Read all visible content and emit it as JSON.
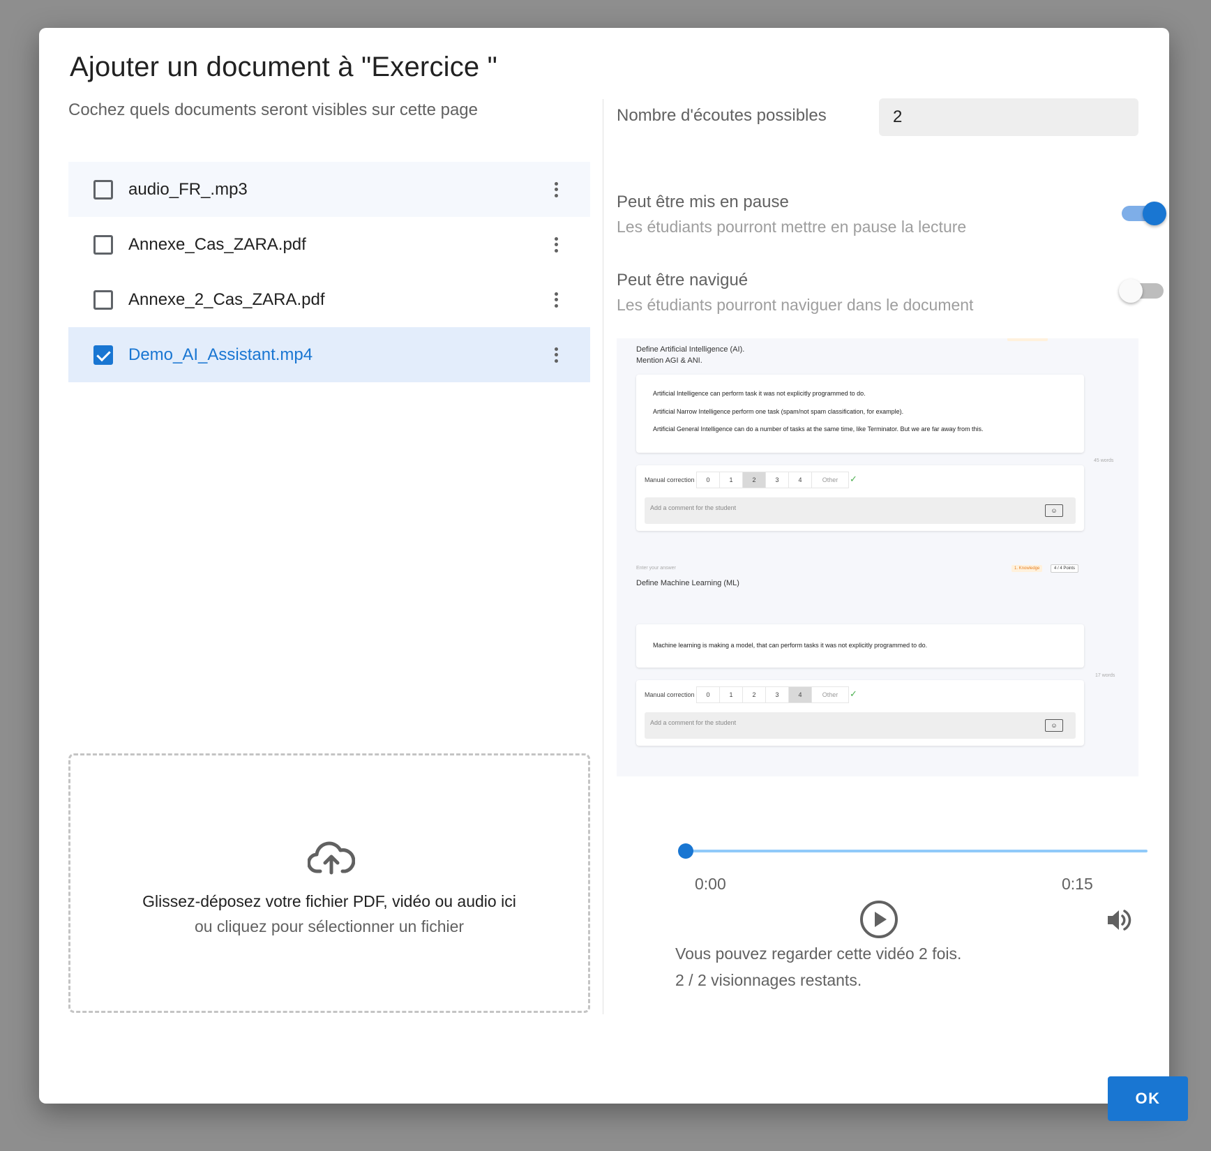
{
  "dialog": {
    "title": "Ajouter un document à \"Exercice \"",
    "subtitle": "Cochez quels documents seront visibles sur cette page",
    "ok_label": "OK"
  },
  "files": [
    {
      "name": "audio_FR_.mp3",
      "checked": false
    },
    {
      "name": "Annexe_Cas_ZARA.pdf",
      "checked": false
    },
    {
      "name": "Annexe_2_Cas_ZARA.pdf",
      "checked": false
    },
    {
      "name": "Demo_AI_Assistant.mp4",
      "checked": true
    }
  ],
  "dropzone": {
    "icon": "cloud-upload-icon",
    "title": "Glissez-déposez votre fichier PDF, vidéo ou audio ici",
    "subtitle": "ou cliquez pour sélectionner un fichier"
  },
  "settings": {
    "plays_label": "Nombre d'écoutes possibles",
    "plays_value": "2",
    "pause": {
      "title": "Peut être mis en pause",
      "description": "Les étudiants pourront mettre en pause la lecture",
      "enabled": true
    },
    "navigate": {
      "title": "Peut être navigué",
      "description": "Les étudiants pourront naviguer dans le document",
      "enabled": false
    }
  },
  "preview": {
    "q1_prompt": "Define Artificial Intelligence (AI).",
    "q1_prompt2": "Mention AGI & ANI.",
    "q1_answer": [
      "Artificial Intelligence can perform task it was not explicitly programmed to do.",
      "Artificial Narrow Intelligence perform one task (spam/not spam classification, for example).",
      "Artificial General Intelligence can do a number of tasks at the same time, like Terminator. But we are far away from this."
    ],
    "q1_words": "45 words",
    "manual_correction": "Manual correction",
    "scores": [
      "0",
      "1",
      "2",
      "3",
      "4",
      "Other"
    ],
    "q1_selected": 2,
    "comment_placeholder": "Add a comment for the student",
    "q2_hint": "Enter your answer",
    "q2_tag": "1. Knowledge",
    "q2_points": "4 / 4 Points",
    "q2_prompt": "Define Machine Learning (ML)",
    "q2_answer": "Machine learning is making a model, that can perform tasks it was not explicitly programmed to do.",
    "q2_words": "17 words",
    "q2_selected": 4
  },
  "player": {
    "current_time": "0:00",
    "duration": "0:15",
    "progress": 0,
    "info_line1": "Vous pouvez regarder cette vidéo 2 fois.",
    "info_line2": "2 / 2 visionnages restants."
  },
  "colors": {
    "accent": "#1976d2",
    "selected_row": "#e3edfb",
    "overlay": "#8e8e8e"
  }
}
